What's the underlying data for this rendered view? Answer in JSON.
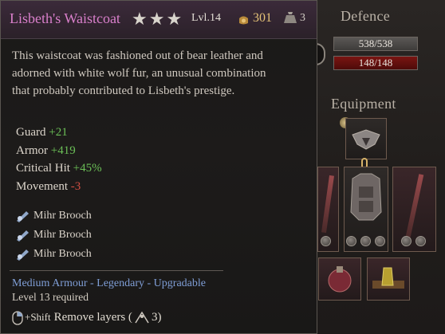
{
  "item": {
    "name": "Lisbeth's Waistcoat",
    "stars": "★★★",
    "level": "Lvl.14",
    "gold": "301",
    "weight": "3",
    "description": "This waistcoat was fashioned out of bear leather and adorned with white wolf fur, an unusual combination that probably contributed to Lisbeth's prestige.",
    "stats": [
      {
        "label": "Guard",
        "value": "+21"
      },
      {
        "label": "Armor",
        "value": "+419"
      },
      {
        "label": "Critical Hit",
        "value": "+45%"
      },
      {
        "label": "Movement",
        "value": "-3"
      }
    ],
    "enchantments": [
      {
        "label": "Mihr Brooch",
        "icon": "brooch-icon"
      },
      {
        "label": "Mihr Brooch",
        "icon": "brooch-icon"
      },
      {
        "label": "Mihr Brooch",
        "icon": "brooch-icon"
      }
    ],
    "category": "Medium Armour - Legendary - Upgradable",
    "requirement": "Level 13 required"
  },
  "hint": {
    "modifier": "+Shift",
    "action": "Remove layers (",
    "count": "3)"
  },
  "panel": {
    "defence_title": "Defence",
    "equipment_title": "Equipment",
    "armor_bar": "538/538",
    "health_bar": "148/148"
  },
  "colors": {
    "item_name": "#d97fcb",
    "positive": "#6bbf57",
    "negative": "#d14e43",
    "category": "#7f9ed6",
    "gold": "#e5c277"
  }
}
